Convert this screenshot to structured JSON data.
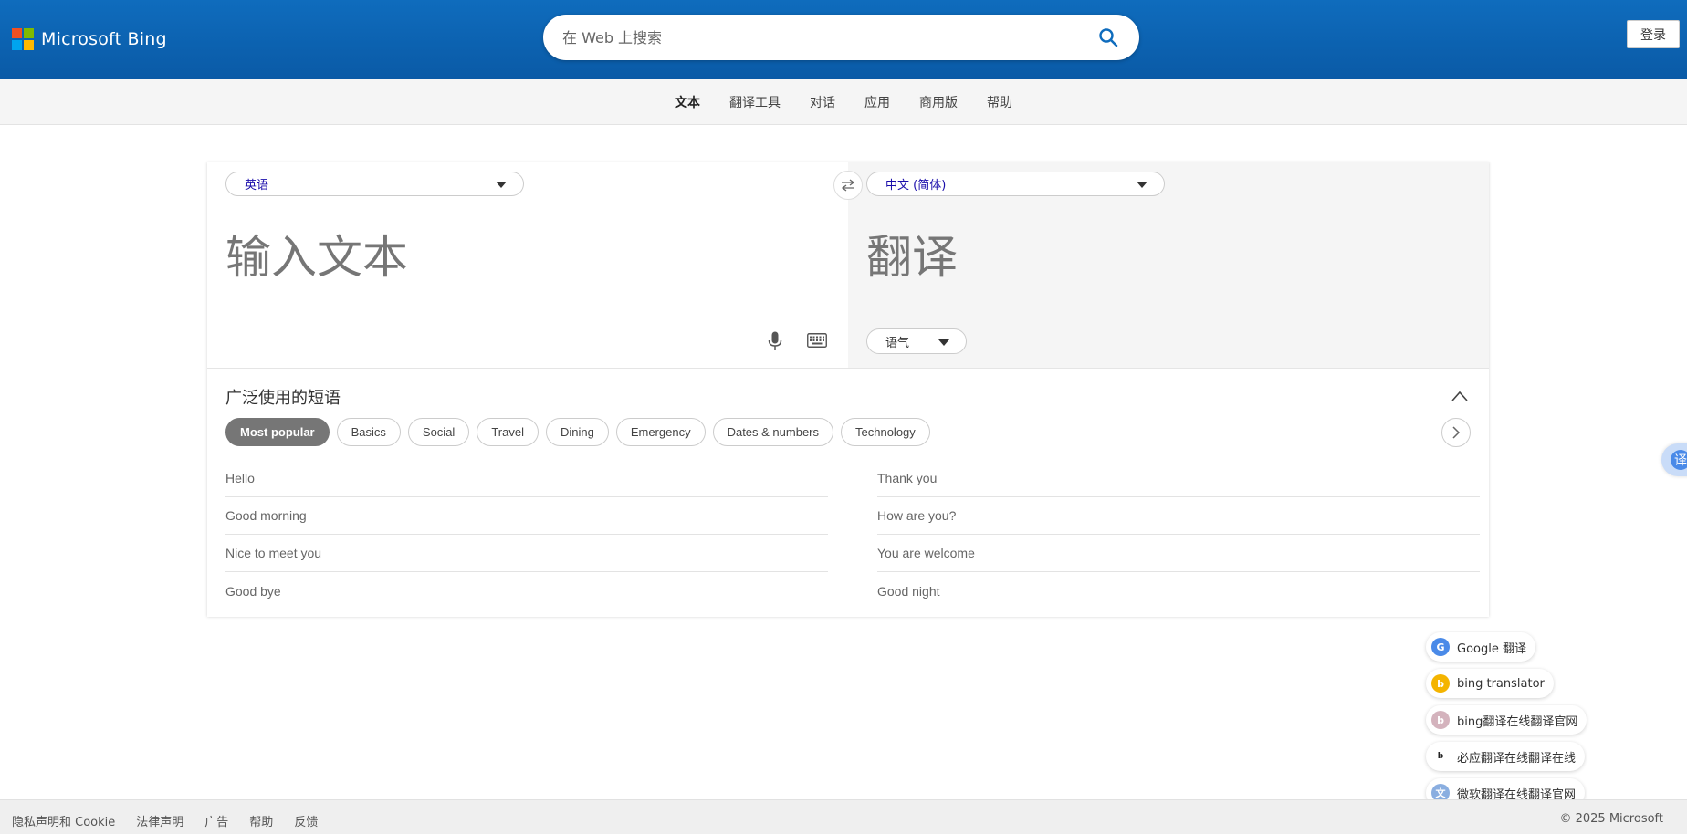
{
  "header": {
    "brand": "Microsoft Bing",
    "search_placeholder": "在 Web 上搜索",
    "login_label": "登录",
    "colors": {
      "bg": "#0f6cbd",
      "ms_red": "#f25022",
      "ms_green": "#7fba00",
      "ms_blue": "#00a4ef",
      "ms_yellow": "#ffb900"
    }
  },
  "nav": {
    "items": [
      {
        "label": "文本"
      },
      {
        "label": "翻译工具"
      },
      {
        "label": "对话"
      },
      {
        "label": "应用"
      },
      {
        "label": "商用版"
      },
      {
        "label": "帮助"
      }
    ]
  },
  "translator": {
    "source_lang": "英语",
    "target_lang": "中文 (简体)",
    "source_placeholder": "输入文本",
    "target_placeholder": "翻译",
    "tone_label": "语气"
  },
  "phrases": {
    "title": "广泛使用的短语",
    "categories": [
      {
        "label": "Most popular"
      },
      {
        "label": "Basics"
      },
      {
        "label": "Social"
      },
      {
        "label": "Travel"
      },
      {
        "label": "Dining"
      },
      {
        "label": "Emergency"
      },
      {
        "label": "Dates & numbers"
      },
      {
        "label": "Technology"
      }
    ],
    "left": [
      {
        "text": "Hello"
      },
      {
        "text": "Good morning"
      },
      {
        "text": "Nice to meet you"
      },
      {
        "text": "Good bye"
      }
    ],
    "right": [
      {
        "text": "Thank you"
      },
      {
        "text": "How are you?"
      },
      {
        "text": "You are welcome"
      },
      {
        "text": "Good night"
      }
    ]
  },
  "side_tab": {
    "label": "译"
  },
  "suggestions": [
    {
      "label": "Google 翻译"
    },
    {
      "label": "bing translator"
    },
    {
      "label": "bing翻译在线翻译官网"
    },
    {
      "label": "必应翻译在线翻译在线"
    },
    {
      "label": "微软翻译在线翻译官网"
    }
  ],
  "footer": {
    "links": [
      {
        "label": "隐私声明和 Cookie"
      },
      {
        "label": "法律声明"
      },
      {
        "label": "广告"
      },
      {
        "label": "帮助"
      },
      {
        "label": "反馈"
      }
    ],
    "copyright": "© 2025 Microsoft"
  }
}
